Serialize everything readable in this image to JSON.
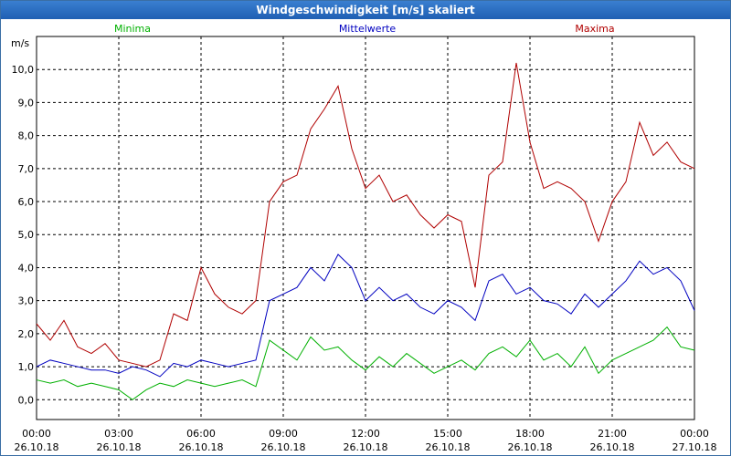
{
  "window": {
    "title": "Windgeschwindigkeit [m/s] skaliert"
  },
  "chart_data": {
    "type": "line",
    "title": "Windgeschwindigkeit [m/s] skaliert",
    "ylabel": "m/s",
    "ylim": [
      -0.6,
      11.0
    ],
    "yticks": [
      "0,0",
      "1,0",
      "2,0",
      "3,0",
      "4,0",
      "5,0",
      "6,0",
      "7,0",
      "8,0",
      "9,0",
      "10,0"
    ],
    "xticks": [
      {
        "time": "00:00",
        "date": "26.10.18"
      },
      {
        "time": "03:00",
        "date": "26.10.18"
      },
      {
        "time": "06:00",
        "date": "26.10.18"
      },
      {
        "time": "09:00",
        "date": "26.10.18"
      },
      {
        "time": "12:00",
        "date": "26.10.18"
      },
      {
        "time": "15:00",
        "date": "26.10.18"
      },
      {
        "time": "18:00",
        "date": "26.10.18"
      },
      {
        "time": "21:00",
        "date": "26.10.18"
      },
      {
        "time": "00:00",
        "date": "27.10.18"
      }
    ],
    "grid": true,
    "x_hours": [
      0,
      0.5,
      1,
      1.5,
      2,
      2.5,
      3,
      3.5,
      4,
      4.5,
      5,
      5.5,
      6,
      6.5,
      7,
      7.5,
      8,
      8.5,
      9,
      9.5,
      10,
      10.5,
      11,
      11.5,
      12,
      12.5,
      13,
      13.5,
      14,
      14.5,
      15,
      15.5,
      16,
      16.5,
      17,
      17.5,
      18,
      18.5,
      19,
      19.5,
      20,
      20.5,
      21,
      21.5,
      22,
      22.5,
      23,
      23.5,
      24
    ],
    "series": [
      {
        "name": "Minima",
        "color": "#00b000",
        "values": [
          0.6,
          0.5,
          0.6,
          0.4,
          0.5,
          0.4,
          0.3,
          0.0,
          0.3,
          0.5,
          0.4,
          0.6,
          0.5,
          0.4,
          0.5,
          0.6,
          0.4,
          1.8,
          1.5,
          1.2,
          1.9,
          1.5,
          1.6,
          1.2,
          0.9,
          1.3,
          1.0,
          1.4,
          1.1,
          0.8,
          1.0,
          1.2,
          0.9,
          1.4,
          1.6,
          1.3,
          1.8,
          1.2,
          1.4,
          1.0,
          1.6,
          0.8,
          1.2,
          1.4,
          1.6,
          1.8,
          2.2,
          1.6,
          1.5
        ]
      },
      {
        "name": "Mittelwerte",
        "color": "#0000c0",
        "values": [
          1.0,
          1.2,
          1.1,
          1.0,
          0.9,
          0.9,
          0.8,
          1.0,
          0.9,
          0.7,
          1.1,
          1.0,
          1.2,
          1.1,
          1.0,
          1.1,
          1.2,
          3.0,
          3.2,
          3.4,
          4.0,
          3.6,
          4.4,
          4.0,
          3.0,
          3.4,
          3.0,
          3.2,
          2.8,
          2.6,
          3.0,
          2.8,
          2.4,
          3.6,
          3.8,
          3.2,
          3.4,
          3.0,
          2.9,
          2.6,
          3.2,
          2.8,
          3.2,
          3.6,
          4.2,
          3.8,
          4.0,
          3.6,
          2.7
        ]
      },
      {
        "name": "Maxima",
        "color": "#b00000",
        "values": [
          2.3,
          1.8,
          2.4,
          1.6,
          1.4,
          1.7,
          1.2,
          1.1,
          1.0,
          1.2,
          2.6,
          2.4,
          4.0,
          3.2,
          2.8,
          2.6,
          3.0,
          6.0,
          6.6,
          6.8,
          8.2,
          8.8,
          9.5,
          7.6,
          6.4,
          6.8,
          6.0,
          6.2,
          5.6,
          5.2,
          5.6,
          5.4,
          3.4,
          6.8,
          7.2,
          10.2,
          7.8,
          6.4,
          6.6,
          6.4,
          6.0,
          4.8,
          6.0,
          6.6,
          8.4,
          7.4,
          7.8,
          7.2,
          7.0
        ]
      }
    ]
  }
}
